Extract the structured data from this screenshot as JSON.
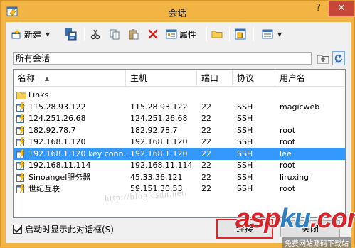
{
  "window": {
    "title": "会话"
  },
  "titlebar_buttons": {
    "help": "?",
    "close": "✕"
  },
  "toolbar": {
    "new_label": "新建",
    "properties_label": "属性"
  },
  "path": {
    "value": "所有会话"
  },
  "columns": [
    "名称",
    "主机",
    "端口",
    "协议",
    "用户名"
  ],
  "sessions": [
    {
      "name": "Links",
      "host": "",
      "port": "",
      "protocol": "",
      "user": "",
      "type": "folder",
      "selected": false
    },
    {
      "name": "115.28.93.122",
      "host": "115.28.93.122",
      "port": "22",
      "protocol": "SSH",
      "user": "magicweb",
      "type": "session",
      "selected": false
    },
    {
      "name": "124.251.26.68",
      "host": "124.251.26.68",
      "port": "22",
      "protocol": "SSH",
      "user": "",
      "type": "session",
      "selected": false
    },
    {
      "name": "182.92.78.7",
      "host": "182.92.78.7",
      "port": "22",
      "protocol": "SSH",
      "user": "root",
      "type": "session",
      "selected": false
    },
    {
      "name": "192.168.1.120",
      "host": "192.168.1.120",
      "port": "22",
      "protocol": "SSH",
      "user": "root",
      "type": "session",
      "selected": false
    },
    {
      "name": "192.168.1.120 key conn...",
      "host": "192.168.1.120",
      "port": "22",
      "protocol": "SSH",
      "user": "lee",
      "type": "session",
      "selected": true
    },
    {
      "name": "192.168.11.114",
      "host": "192.168.11.114",
      "port": "22",
      "protocol": "SSH",
      "user": "root",
      "type": "session",
      "selected": false
    },
    {
      "name": "Sinoangel服务器",
      "host": "45.33.36.121",
      "port": "22",
      "protocol": "SSH",
      "user": "liruxing",
      "type": "session",
      "selected": false
    },
    {
      "name": "世纪互联",
      "host": "59.151.30.53",
      "port": "22",
      "protocol": "SSH",
      "user": "root",
      "type": "session",
      "selected": false
    }
  ],
  "watermark": "http://blog.csdn.net/",
  "footer": {
    "startup_checkbox_label": "启动时显示此对话框(S)",
    "startup_checked": true,
    "connect_label": "连接",
    "cancel_label": "关闭"
  },
  "brand": {
    "text_main": "asp",
    "text_k": "ku",
    "text_end": ".com",
    "subtitle": "免费网站源码下载站"
  },
  "colors": {
    "frame": "#f2b544",
    "selection": "#3399ff",
    "close": "#c7473a",
    "highlight_border": "#e0242a"
  },
  "icons": [
    "app-icon",
    "new-icon",
    "save-icon",
    "cut-icon",
    "copy-icon",
    "paste-icon",
    "delete-icon",
    "properties-icon",
    "folder-icon",
    "session-manager-icon",
    "view-icon",
    "folder-up-icon",
    "refresh-icon",
    "session-icon"
  ]
}
